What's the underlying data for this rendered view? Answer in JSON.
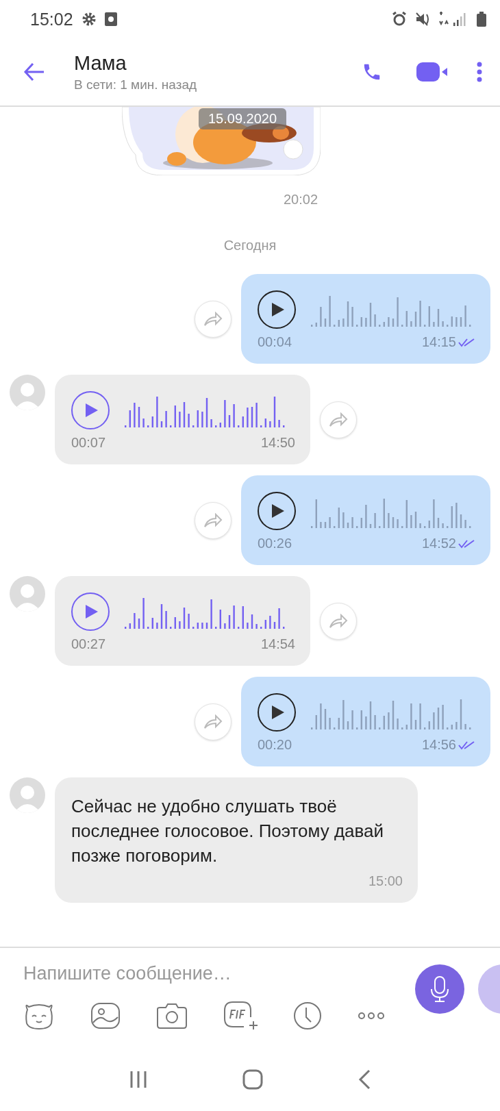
{
  "status_bar": {
    "time": "15:02"
  },
  "header": {
    "title": "Мама",
    "subtitle": "В сети: 1 мин. назад"
  },
  "sticker": {
    "kind": "picture",
    "date_badge": "15.09.2020",
    "time": "20:02"
  },
  "day_divider": "Сегодня",
  "messages": [
    {
      "kind": "voice",
      "outgoing": true,
      "duration": "00:04",
      "time": "14:15",
      "read": true
    },
    {
      "kind": "voice",
      "outgoing": false,
      "duration": "00:07",
      "time": "14:50"
    },
    {
      "kind": "voice",
      "outgoing": true,
      "duration": "00:26",
      "time": "14:52",
      "read": true
    },
    {
      "kind": "voice",
      "outgoing": false,
      "duration": "00:27",
      "time": "14:54"
    },
    {
      "kind": "voice",
      "outgoing": true,
      "duration": "00:20",
      "time": "14:56",
      "read": true
    },
    {
      "kind": "text",
      "outgoing": false,
      "text": "Сейчас не удобно слушать твоё последнее голосовое. Поэтому давай позже поговорим.",
      "time": "15:00"
    }
  ],
  "composer": {
    "placeholder": "Напишите сообщение…"
  }
}
